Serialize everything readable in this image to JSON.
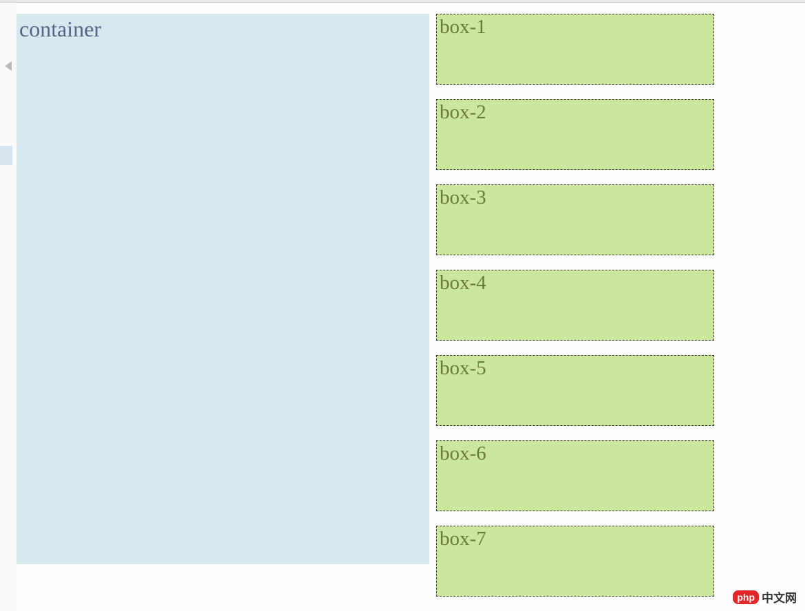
{
  "container": {
    "label": "container"
  },
  "boxes": [
    {
      "label": "box-1"
    },
    {
      "label": "box-2"
    },
    {
      "label": "box-3"
    },
    {
      "label": "box-4"
    },
    {
      "label": "box-5"
    },
    {
      "label": "box-6"
    },
    {
      "label": "box-7"
    }
  ],
  "watermark": {
    "badge": "php",
    "text": "中文网"
  }
}
